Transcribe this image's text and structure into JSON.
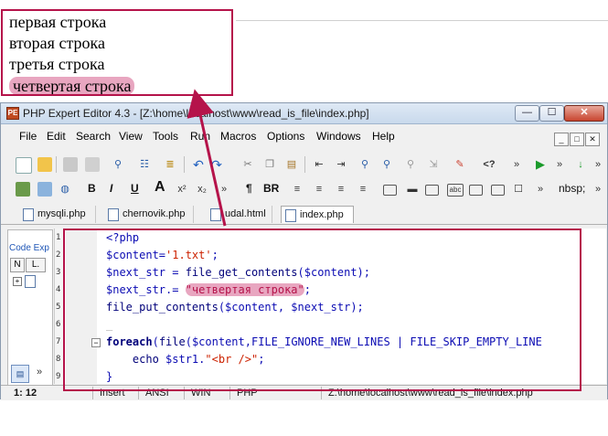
{
  "browser": {
    "lines": [
      "первая строка",
      "вторая строка",
      "третья строка",
      "четвертая строка"
    ]
  },
  "window": {
    "title": "PHP Expert Editor 4.3 - [Z:\\home\\localhost\\www\\read_is_file\\index.php]",
    "icon_text": "PE"
  },
  "menu": [
    "File",
    "Edit",
    "Search",
    "View",
    "Tools",
    "Run",
    "Macros",
    "Options",
    "Windows",
    "Help"
  ],
  "toolbar2": {
    "bold": "B",
    "italic": "I",
    "underline": "U",
    "pilcrow": "¶",
    "br": "BR",
    "nbsp": "nbsp;",
    "tag": "<?"
  },
  "tabs": [
    "mysqli.php",
    "chernovik.php",
    "udal.html",
    "index.php"
  ],
  "side_panel": {
    "title": "Code Exp",
    "hdr1": "N",
    "hdr2": "L."
  },
  "editor": {
    "line_numbers": [
      "1",
      "2",
      "3",
      "4",
      "5",
      "6",
      "7",
      "8",
      "9"
    ],
    "lines": {
      "l1": "<?php",
      "l2a": "$content=",
      "l2b": "'1.txt'",
      "l2c": ";",
      "l3a": "$next_str = ",
      "l3b": "file_get_contents",
      "l3c": "($content);",
      "l4a": "$next_str.= ",
      "l4b": "\"четвертая строка\"",
      "l4c": ";",
      "l5a": "file_put_contents",
      "l5b": "($content, $next_str);",
      "l6": "_",
      "l7a": "foreach",
      "l7b": "(",
      "l7c": "file",
      "l7d": "($content,FILE_IGNORE_NEW_LINES | FILE_SKIP_EMPTY_LINE",
      "l8a": "    echo ",
      "l8b": "$str1.",
      "l8c": "\"<br />\"",
      "l8d": ";",
      "l9": "}"
    }
  },
  "status": {
    "position": "1: 12",
    "mode": "Insert",
    "encoding": "ANSI",
    "line_end": "WIN",
    "syntax": "PHP",
    "path": "Z:\\home\\localhost\\www\\read_is_file\\index.php"
  },
  "colors": {
    "annotation": "#b5134a",
    "highlight": "#e8a6c0"
  }
}
